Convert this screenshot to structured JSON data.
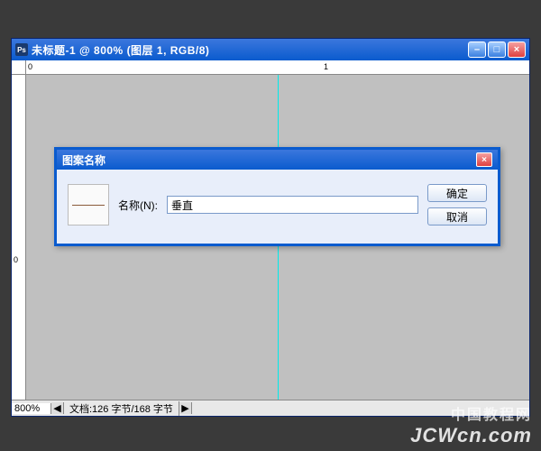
{
  "window": {
    "app_badge": "Ps",
    "title": "未标题-1 @ 800% (图层 1, RGB/8)",
    "buttons": {
      "min": "–",
      "max": "□",
      "close": "×"
    }
  },
  "rulers": {
    "h": {
      "tick0": "0",
      "tick1": "1"
    },
    "v": {
      "tick0": "0"
    }
  },
  "status": {
    "zoom": "800%",
    "arrow_left": "◀",
    "docinfo": "文档:126 字节/168 字节",
    "arrow_right": "▶"
  },
  "dialog": {
    "title": "图案名称",
    "close": "×",
    "field_label": "名称(N):",
    "name_value": "垂直",
    "ok": "确定",
    "cancel": "取消"
  },
  "watermark": {
    "cn": "中国教程网",
    "url": "JCWcn.com"
  }
}
